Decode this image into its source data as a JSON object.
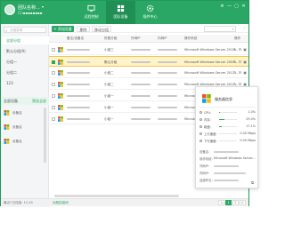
{
  "colors": {
    "brand": "#2aa764",
    "brand_dark": "#1f8f54",
    "selected_row": "#fff3c9"
  },
  "user": {
    "name": "团队名称…",
    "subtitle": "(1)▪▪▪▪▪▪▪▪",
    "dropdown_glyph": "▾"
  },
  "nav": [
    {
      "label": "远程控制",
      "icon": "monitor-icon"
    },
    {
      "label": "团队设备",
      "icon": "devices-icon"
    },
    {
      "label": "插件中心",
      "icon": "gear-icon"
    }
  ],
  "window_controls": {
    "menu": "≡",
    "minimize": "—",
    "maximize": "▢",
    "close": "✕"
  },
  "sidebar": {
    "search_placeholder": "分组查询",
    "groups": [
      "全部分组",
      "默认分组(9)",
      "分组一",
      "分组二",
      "123"
    ],
    "bottom_label": "全部设备",
    "bottom_action": "筛选全部",
    "devices": [
      "设备名",
      "设备名",
      "设备名"
    ]
  },
  "toolbar": {
    "add_label": "+ 添加设备",
    "buttons": [
      "删除",
      "移动分组"
    ],
    "more_glyph": "⋮",
    "search_icon": "search-icon"
  },
  "table": {
    "columns": [
      "备注/设备名",
      "所属分组",
      "外网IP",
      "内网IP",
      "操作系统",
      "操作"
    ],
    "rows": [
      {
        "group": "小组三",
        "os": "Microsoft Windows Server 2016...",
        "selected": false
      },
      {
        "group": "默认分组",
        "os": "Microsoft Windows Server 2008...",
        "selected": true
      },
      {
        "group": "小组二",
        "os": "Microsoft Windows Server 2012...",
        "selected": false
      },
      {
        "group": "小组二",
        "os": "Microsoft Windows Server 2012...",
        "selected": false
      },
      {
        "group": "小组一",
        "os": "Microsoft Windows Server 2008...",
        "selected": false
      },
      {
        "group": "小组一",
        "os": "Microsoft Windows Server 2008...",
        "selected": false
      },
      {
        "group": "小组一",
        "os": "Microsoft Windows Server 2016...",
        "selected": false
      }
    ]
  },
  "popup": {
    "title": "服务器信息",
    "stats": [
      {
        "label": "CPU：",
        "value": "1.0%",
        "fraction": 0.01
      },
      {
        "label": "内存：",
        "value": "29.0%",
        "fraction": 0.29
      },
      {
        "label": "磁盘：",
        "value": "17.1%",
        "fraction": 0.171
      },
      {
        "label": "上行速度：",
        "value": "0.00 Mbps",
        "fraction": 0
      },
      {
        "label": "下行速度：",
        "value": "0.00 Mbps",
        "fraction": 0
      }
    ],
    "info": [
      {
        "key": "设备名：",
        "value": ""
      },
      {
        "key": "操作系统：",
        "value": "Microsoft Windows Server..."
      },
      {
        "key": "外网IP：",
        "value": ""
      },
      {
        "key": "内网IP：",
        "value": ""
      },
      {
        "key": "连接时长：",
        "value": ""
      }
    ],
    "foot_glyph": "⧉"
  },
  "statusbar": {
    "left": "最近7日连接: 12.45",
    "link": "远程连接码",
    "pages": [
      "<",
      "1",
      "2",
      ">"
    ]
  }
}
